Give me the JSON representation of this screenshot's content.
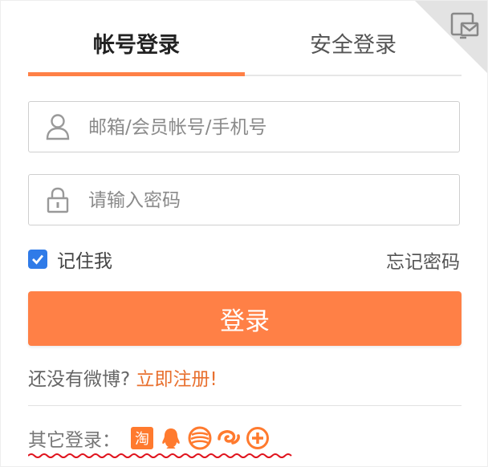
{
  "tabs": {
    "account_login": "帐号登录",
    "secure_login": "安全登录",
    "active": "account_login"
  },
  "corner": {
    "icon": "monitor-mail-icon"
  },
  "form": {
    "username": {
      "placeholder": "邮箱/会员帐号/手机号",
      "value": "",
      "icon": "user-icon"
    },
    "password": {
      "placeholder": "请输入密码",
      "value": "",
      "icon": "lock-icon"
    },
    "remember": {
      "label": "记住我",
      "checked": true
    },
    "forgot_label": "忘记密码",
    "submit_label": "登录"
  },
  "register": {
    "prompt": "还没有微博?",
    "link": "立即注册!"
  },
  "other_login": {
    "label": "其它登录：",
    "providers": [
      {
        "name": "taobao",
        "icon": "taobao-icon",
        "glyph": "淘"
      },
      {
        "name": "qq",
        "icon": "qq-icon"
      },
      {
        "name": "china-mobile",
        "icon": "china-mobile-icon"
      },
      {
        "name": "tianyi",
        "icon": "tianyi-icon"
      },
      {
        "name": "plus",
        "icon": "plus-icon"
      }
    ]
  },
  "colors": {
    "accent": "#ff8046",
    "link": "#e8702f",
    "checkbox": "#2f7be8"
  }
}
